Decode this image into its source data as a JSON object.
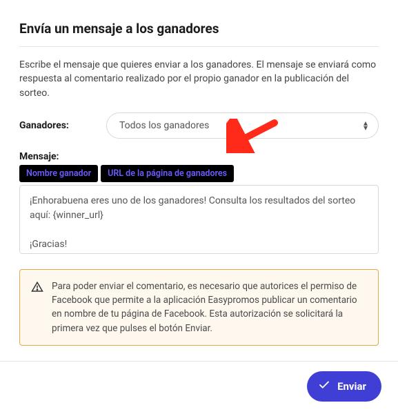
{
  "title": "Envía un mensaje a los ganadores",
  "description": "Escribe el mensaje que quieres enviar a los ganadores. El mensaje se enviará como respuesta al comentario realizado por el propio ganador en la publicación del sorteo.",
  "winners_label": "Ganadores:",
  "winners_select": {
    "value": "Todos los ganadores"
  },
  "message_label": "Mensaje:",
  "tags": {
    "winner_name": "Nombre ganador",
    "winners_url": "URL de la página de ganadores"
  },
  "message_value": "¡Enhorabuena eres uno de los ganadores! Consulta los resultados del sorteo aquí: {winner_url}\n\n¡Gracias!",
  "warning_text": "Para poder enviar el comentario, es necesario que autorices el permiso de Facebook que permite a la aplicación Easypromos publicar un comentario en nombre de tu página de Facebook. Esta autorización se solicitará la primera vez que pulses el botón Enviar.",
  "send_label": "Enviar",
  "colors": {
    "accent": "#3f3fd6",
    "tag_bg": "#000",
    "tag_fg": "#6a5cff",
    "warn_border": "#e8a54a",
    "warn_bg": "#fff8ef",
    "arrow": "#ff2a1a"
  }
}
